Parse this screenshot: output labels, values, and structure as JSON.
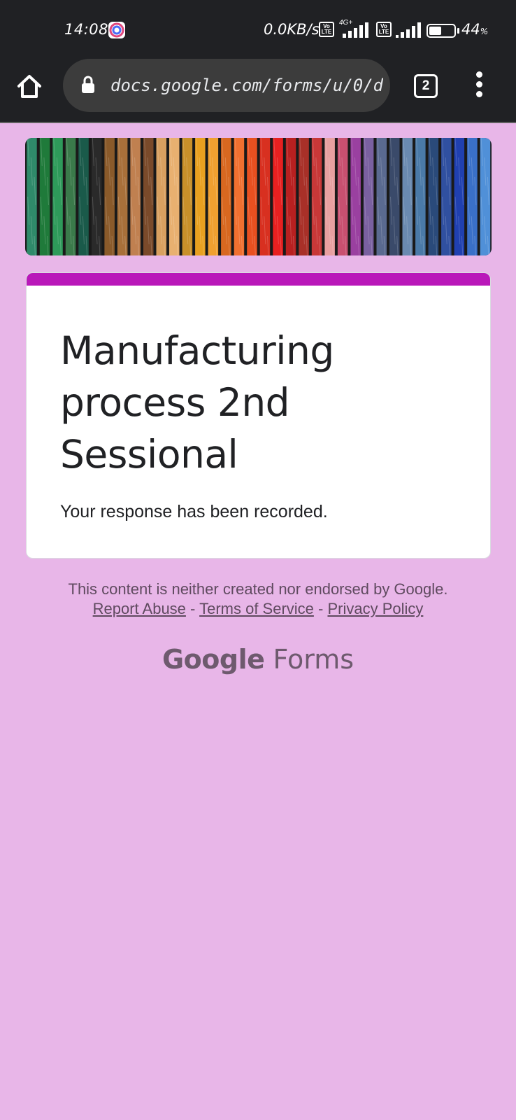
{
  "status_bar": {
    "time": "14:08",
    "net_speed": "0.0KB/s",
    "volte_1": "Vo LTE",
    "network_type": "4G+",
    "volte_2": "Vo LTE",
    "battery_percent": "44",
    "battery_unit": "%",
    "battery_level": 0.44,
    "app_icon": "notification-app-icon"
  },
  "browser": {
    "home_icon": "home-icon",
    "lock_icon": "lock-icon",
    "url": "docs.google.com/forms/u/0/d",
    "tab_count": "2",
    "menu_icon": "more-vert-icon"
  },
  "form": {
    "banner_image": "colorful-yarn-banner",
    "accent_color": "#b917b9",
    "background_color": "#e8b6e8",
    "title": "Manufacturing process 2nd Sessional",
    "confirmation": "Your response has been recorded."
  },
  "footer": {
    "disclaimer": "This content is neither created nor endorsed by Google.",
    "report_abuse": "Report Abuse",
    "separator_1": " - ",
    "terms": "Terms of Service",
    "separator_2": " - ",
    "privacy": "Privacy Policy",
    "brand_google": "Google",
    "brand_forms": "Forms"
  }
}
